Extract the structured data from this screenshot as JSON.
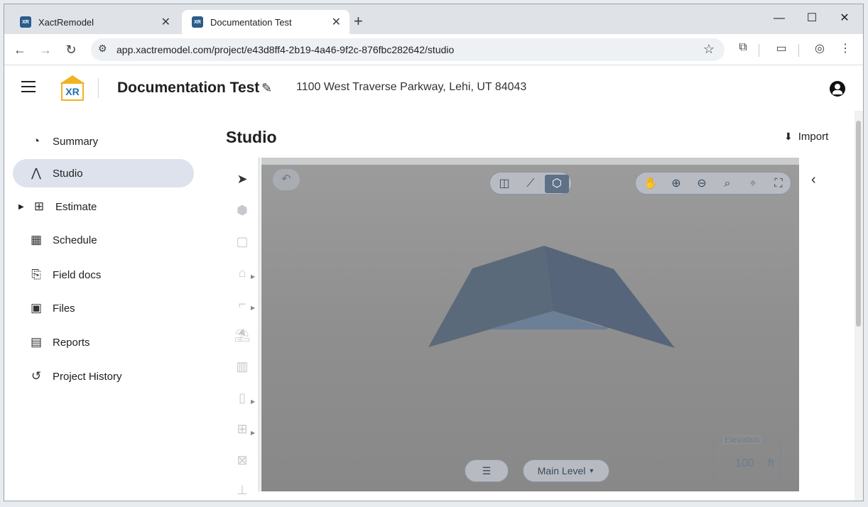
{
  "browser": {
    "tabs": [
      {
        "title": "XactRemodel",
        "close": "✕"
      },
      {
        "title": "Documentation Test",
        "close": "✕"
      }
    ],
    "new_tab": "+",
    "url": "app.xactremodel.com/project/e43d8ff4-2b19-4a46-9f2c-876fbc282642/studio"
  },
  "header": {
    "logo_text": "XR",
    "project_title": "Documentation Test",
    "address": "1100 West Traverse Parkway, Lehi, UT 84043"
  },
  "sidebar": {
    "items": [
      {
        "label": "Summary",
        "icon": "gauge-icon"
      },
      {
        "label": "Studio",
        "icon": "compass-icon",
        "active": true
      },
      {
        "label": "Estimate",
        "icon": "calculator-icon"
      },
      {
        "label": "Schedule",
        "icon": "calendar-icon"
      },
      {
        "label": "Field docs",
        "icon": "clipboard-plus-icon"
      },
      {
        "label": "Files",
        "icon": "images-icon"
      },
      {
        "label": "Reports",
        "icon": "document-icon"
      },
      {
        "label": "Project History",
        "icon": "history-icon"
      }
    ]
  },
  "main": {
    "title": "Studio",
    "import_label": "Import",
    "elevation_label": "Elevation",
    "elevation_value": "100",
    "elevation_unit": "ft",
    "level_label": "Main Level",
    "view_mode_selected": "3d"
  },
  "colors": {
    "accent": "#5f7186",
    "logo_yellow": "#f0b323",
    "logo_blue": "#1a6fb5",
    "roof": "#5a6878"
  }
}
